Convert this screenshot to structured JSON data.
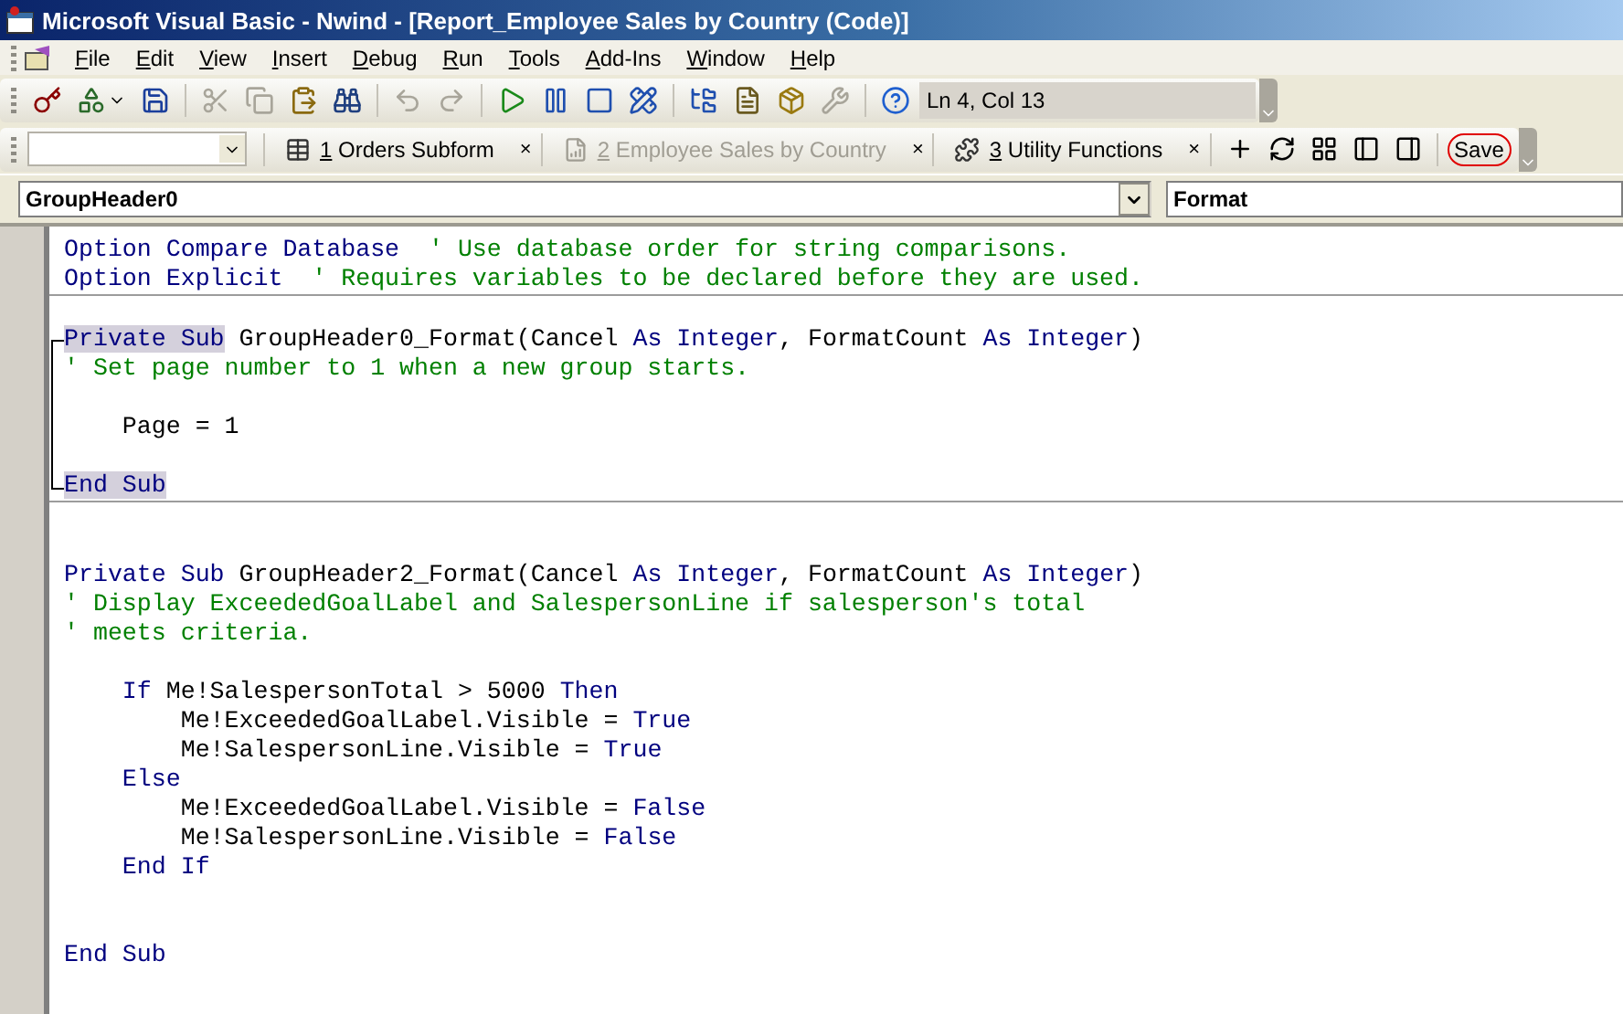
{
  "window": {
    "title": "Microsoft Visual Basic - Nwind - [Report_Employee Sales by Country (Code)]"
  },
  "menu": [
    "File",
    "Edit",
    "View",
    "Insert",
    "Debug",
    "Run",
    "Tools",
    "Add-Ins",
    "Window",
    "Help"
  ],
  "standard_toolbar": {
    "buttons": [
      {
        "kind": "access",
        "disabled": false,
        "caret": false
      },
      {
        "kind": "insert",
        "disabled": false,
        "caret": true
      },
      {
        "kind": "save",
        "disabled": false,
        "caret": false
      },
      {
        "kind": "separator"
      },
      {
        "kind": "cut",
        "disabled": true,
        "caret": false
      },
      {
        "kind": "copy",
        "disabled": true,
        "caret": false
      },
      {
        "kind": "paste",
        "disabled": false,
        "caret": false
      },
      {
        "kind": "find",
        "disabled": false,
        "caret": false
      },
      {
        "kind": "separator"
      },
      {
        "kind": "undo",
        "disabled": true,
        "caret": false
      },
      {
        "kind": "redo",
        "disabled": true,
        "caret": false
      },
      {
        "kind": "separator"
      },
      {
        "kind": "run",
        "disabled": false,
        "caret": false
      },
      {
        "kind": "pause",
        "disabled": false,
        "caret": false
      },
      {
        "kind": "stop",
        "disabled": false,
        "caret": false
      },
      {
        "kind": "design",
        "disabled": false,
        "caret": false
      },
      {
        "kind": "separator"
      },
      {
        "kind": "explorer",
        "disabled": false,
        "caret": false
      },
      {
        "kind": "properties",
        "disabled": false,
        "caret": false
      },
      {
        "kind": "browser",
        "disabled": false,
        "caret": false
      },
      {
        "kind": "toolbox",
        "disabled": true,
        "caret": false
      },
      {
        "kind": "separator"
      },
      {
        "kind": "help",
        "disabled": false,
        "caret": false
      }
    ],
    "position": "Ln 4, Col 13"
  },
  "tabs_toolbar": {
    "tabs": [
      {
        "number": "1",
        "label": "Orders Subform",
        "kind": "form",
        "disabled": false,
        "close": "×"
      },
      {
        "number": "2",
        "label": "Employee Sales by Country",
        "kind": "report",
        "disabled": true,
        "close": "×"
      },
      {
        "number": "3",
        "label": "Utility Functions",
        "kind": "module",
        "disabled": false,
        "close": "×"
      }
    ],
    "save": {
      "label": "Save",
      "circled": true
    }
  },
  "object_box": {
    "value": "GroupHeader0"
  },
  "procedure_box": {
    "value": "Format"
  },
  "procedures": [
    {
      "selected": false,
      "lines": [
        {
          "tokens": [
            {
              "kind": "keyword",
              "text": "Option Compare Database"
            },
            {
              "kind": "comment",
              "text": "  ' Use database order for string comparisons."
            }
          ]
        },
        {
          "tokens": [
            {
              "kind": "keyword",
              "text": "Option Explicit"
            },
            {
              "kind": "comment",
              "text": "  ' Requires variables to be declared before they are used."
            }
          ]
        }
      ]
    },
    {
      "selected": true,
      "lines": [
        {
          "kind": "blank"
        },
        {
          "tokens": [
            {
              "kind": "keyword",
              "text": "Private Sub"
            },
            {
              "kind": "plain",
              "text": " GroupHeader0_Format(Cancel "
            },
            {
              "kind": "keyword",
              "text": "As Integer"
            },
            {
              "kind": "plain",
              "text": ", FormatCount "
            },
            {
              "kind": "keyword",
              "text": "As Integer"
            },
            {
              "kind": "plain",
              "text": ")"
            }
          ]
        },
        {
          "tokens": [
            {
              "kind": "comment",
              "text": "' Set page number to 1 when a new group starts."
            }
          ]
        },
        {
          "kind": "blank"
        },
        {
          "tokens": [
            {
              "kind": "plain",
              "text": "    Page = 1"
            }
          ]
        },
        {
          "kind": "blank"
        },
        {
          "tokens": [
            {
              "kind": "keyword",
              "text": "End Sub"
            }
          ]
        }
      ]
    },
    {
      "selected": false,
      "lines": [
        {
          "kind": "blank"
        },
        {
          "kind": "blank"
        },
        {
          "tokens": [
            {
              "kind": "keyword",
              "text": "Private Sub"
            },
            {
              "kind": "plain",
              "text": " GroupHeader2_Format(Cancel "
            },
            {
              "kind": "keyword",
              "text": "As Integer"
            },
            {
              "kind": "plain",
              "text": ", FormatCount "
            },
            {
              "kind": "keyword",
              "text": "As Integer"
            },
            {
              "kind": "plain",
              "text": ")"
            }
          ]
        },
        {
          "tokens": [
            {
              "kind": "comment",
              "text": "' Display ExceededGoalLabel and SalespersonLine if salesperson's total"
            }
          ]
        },
        {
          "tokens": [
            {
              "kind": "comment",
              "text": "' meets criteria."
            }
          ]
        },
        {
          "kind": "blank"
        },
        {
          "tokens": [
            {
              "kind": "keyword",
              "text": "    If"
            },
            {
              "kind": "plain",
              "text": " Me!SalespersonTotal > 5000 "
            },
            {
              "kind": "keyword",
              "text": "Then"
            }
          ]
        },
        {
          "tokens": [
            {
              "kind": "plain",
              "text": "        Me!ExceededGoalLabel.Visible = "
            },
            {
              "kind": "keyword",
              "text": "True"
            }
          ]
        },
        {
          "tokens": [
            {
              "kind": "plain",
              "text": "        Me!SalespersonLine.Visible = "
            },
            {
              "kind": "keyword",
              "text": "True"
            }
          ]
        },
        {
          "tokens": [
            {
              "kind": "keyword",
              "text": "    Else"
            }
          ]
        },
        {
          "tokens": [
            {
              "kind": "plain",
              "text": "        Me!ExceededGoalLabel.Visible = "
            },
            {
              "kind": "keyword",
              "text": "False"
            }
          ]
        },
        {
          "tokens": [
            {
              "kind": "plain",
              "text": "        Me!SalespersonLine.Visible = "
            },
            {
              "kind": "keyword",
              "text": "False"
            }
          ]
        },
        {
          "tokens": [
            {
              "kind": "keyword",
              "text": "    End If"
            }
          ]
        },
        {
          "kind": "blank"
        },
        {
          "kind": "blank"
        },
        {
          "tokens": [
            {
              "kind": "keyword",
              "text": "End Sub"
            }
          ]
        }
      ]
    }
  ]
}
